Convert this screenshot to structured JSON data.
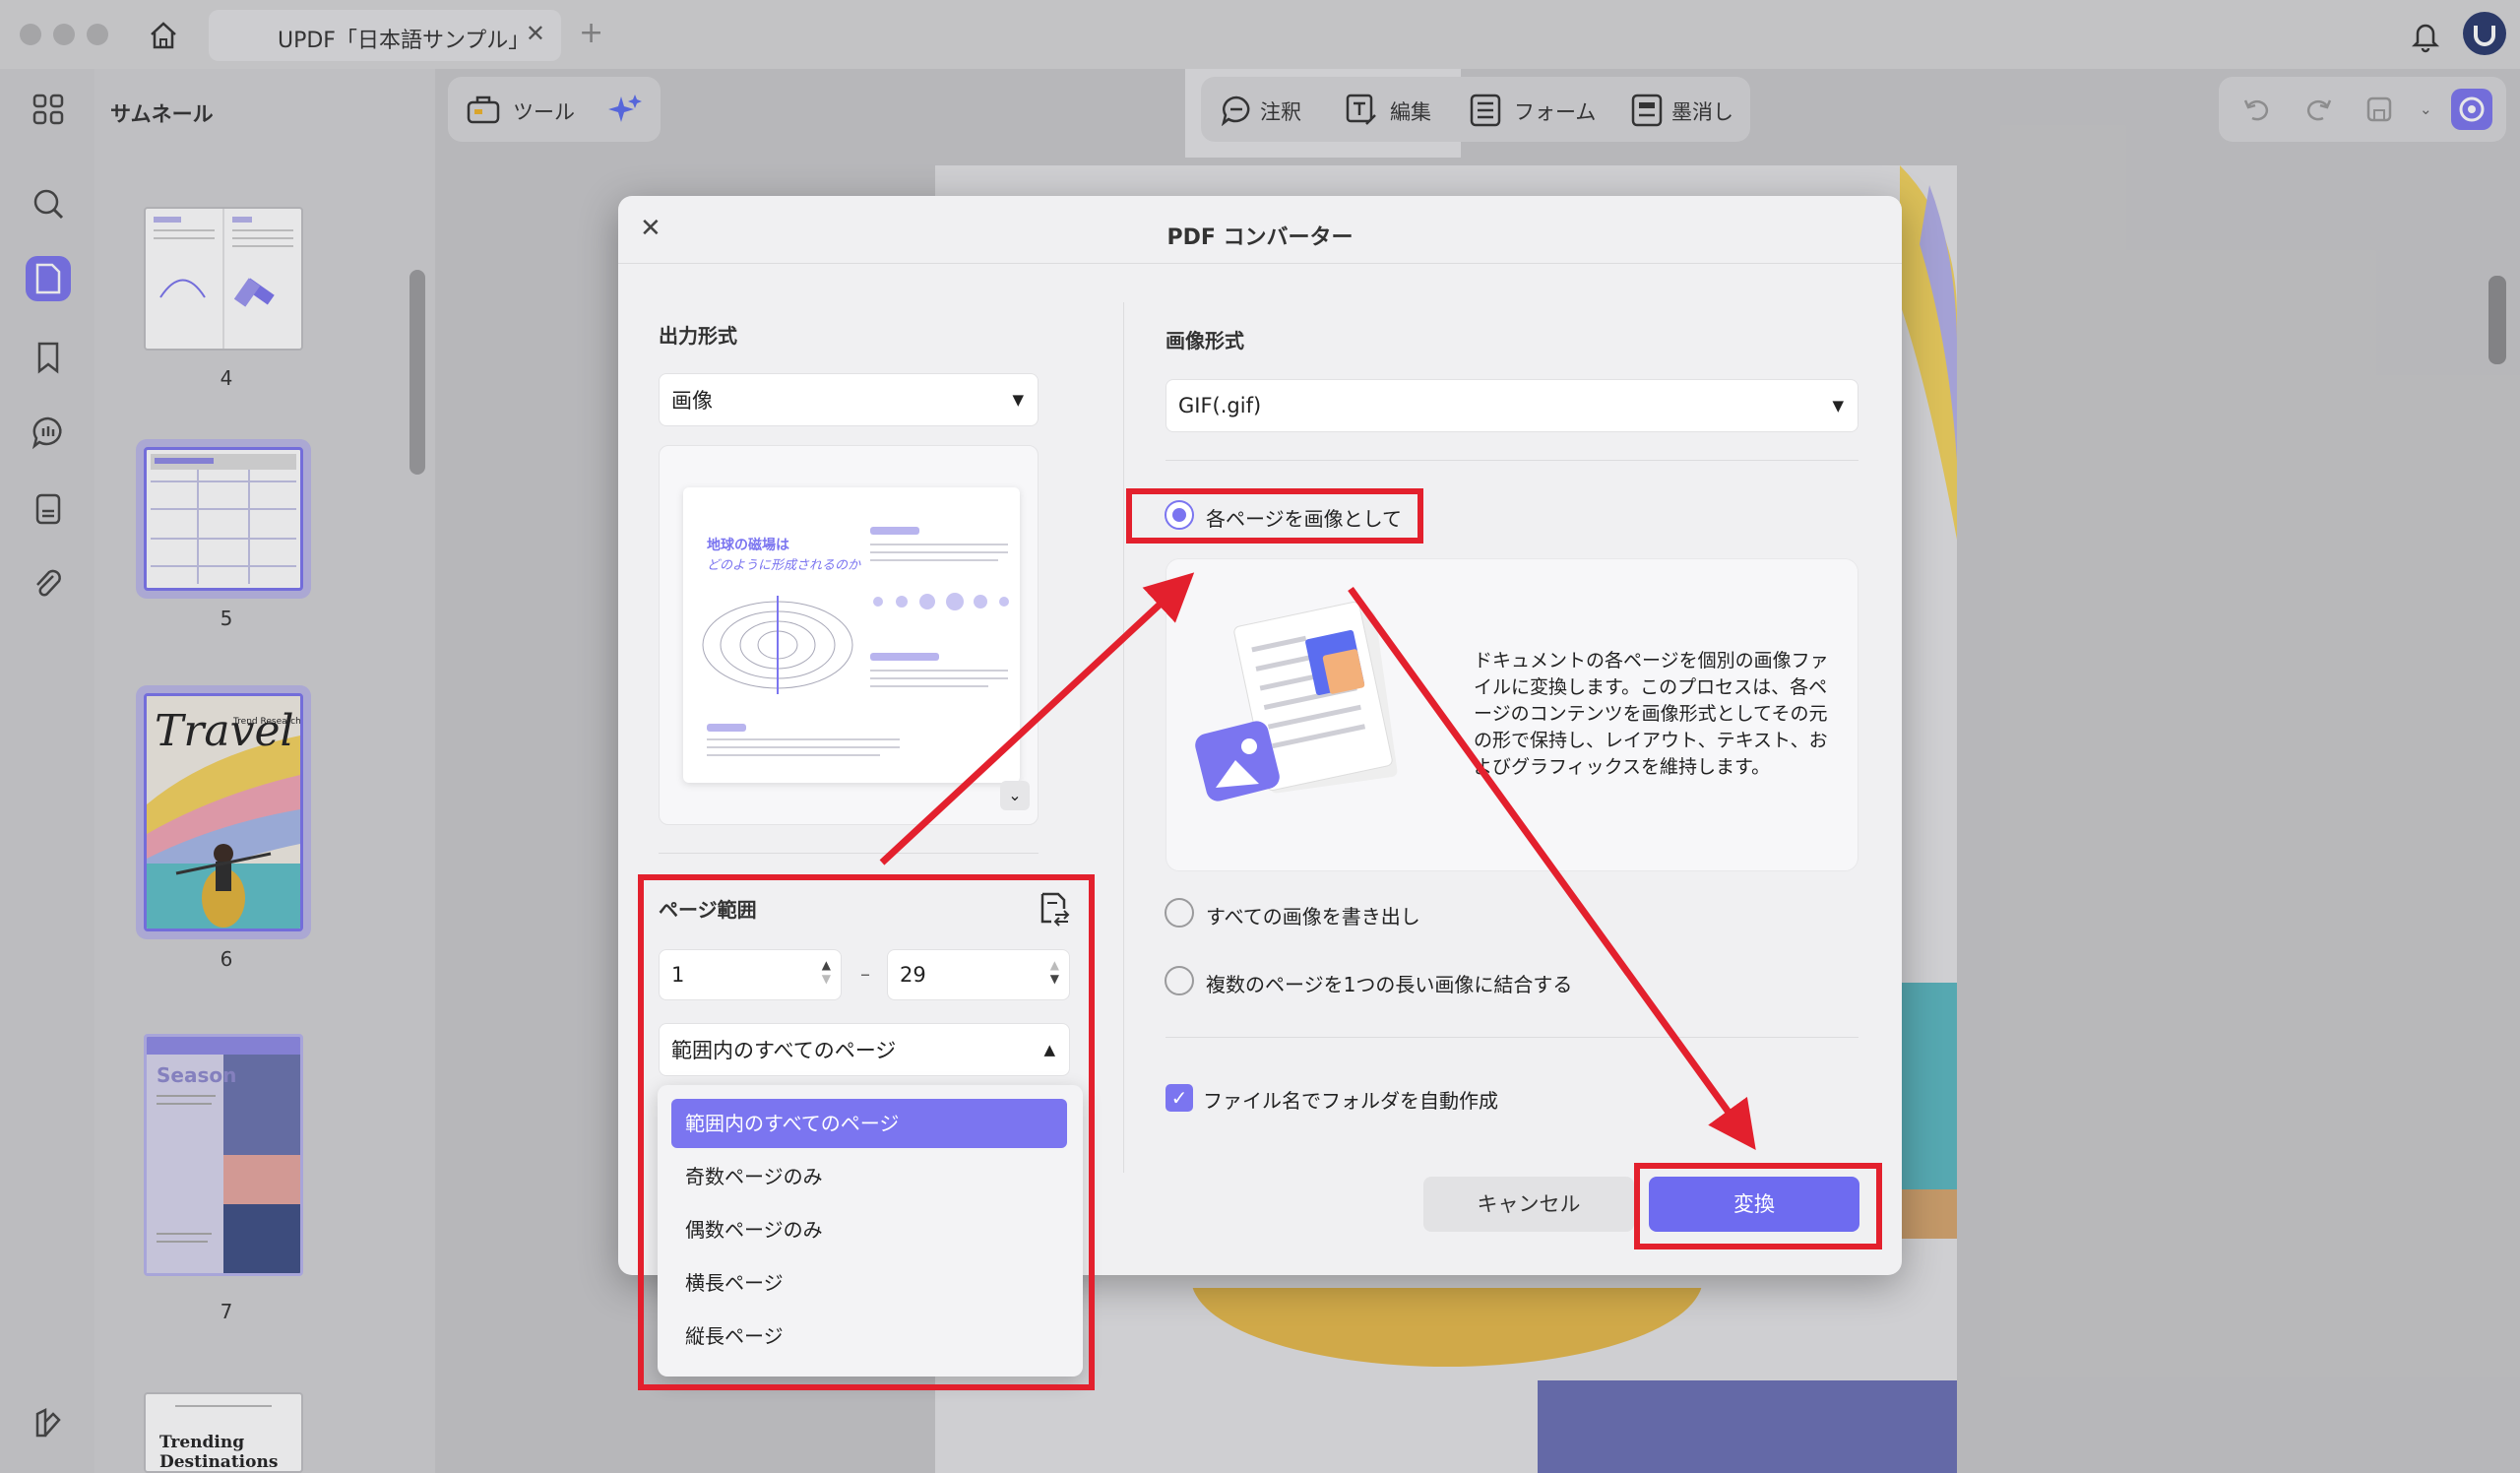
{
  "window": {
    "tab_title": "UPDF「日本語サンプル」"
  },
  "sidebar": {
    "title": "サムネール",
    "page_numbers": [
      "4",
      "5",
      "6",
      "7"
    ],
    "thumb_texts": {
      "travel": "Travel",
      "trend": "Trend Research",
      "season": "Season",
      "trending": "Trending",
      "destinations": "Destinations"
    }
  },
  "toolbar": {
    "tools_label": "ツール",
    "annotate_label": "注釈",
    "edit_label": "編集",
    "form_label": "フォーム",
    "redact_label": "墨消し"
  },
  "dialog": {
    "title": "PDF コンバーター",
    "output_format_label": "出力形式",
    "output_format_value": "画像",
    "preview_heading_1": "地球の磁場は",
    "preview_heading_2": "どのように形成されるのか",
    "page_range_label": "ページ範囲",
    "range_from": "1",
    "range_dash": "–",
    "range_to": "29",
    "range_mode_value": "範囲内のすべてのページ",
    "range_mode_options": [
      "範囲内のすべてのページ",
      "奇数ページのみ",
      "偶数ページのみ",
      "横長ページ",
      "縦長ページ"
    ],
    "image_format_label": "画像形式",
    "image_format_value": "GIF(.gif)",
    "option_each_page": "各ページを画像として",
    "option_description": "ドキュメントの各ページを個別の画像ファイルに変換します。このプロセスは、各ページのコンテンツを画像形式としてその元の形で保持し、レイアウト、テキスト、およびグラフィックスを維持します。",
    "option_export_images": "すべての画像を書き出し",
    "option_combine": "複数のページを1つの長い画像に結合する",
    "checkbox_folder": "ファイル名でフォルダを自動作成",
    "cancel_label": "キャンセル",
    "convert_label": "変換"
  },
  "colors": {
    "accent": "#7b75f0",
    "highlight": "#e3202d"
  }
}
